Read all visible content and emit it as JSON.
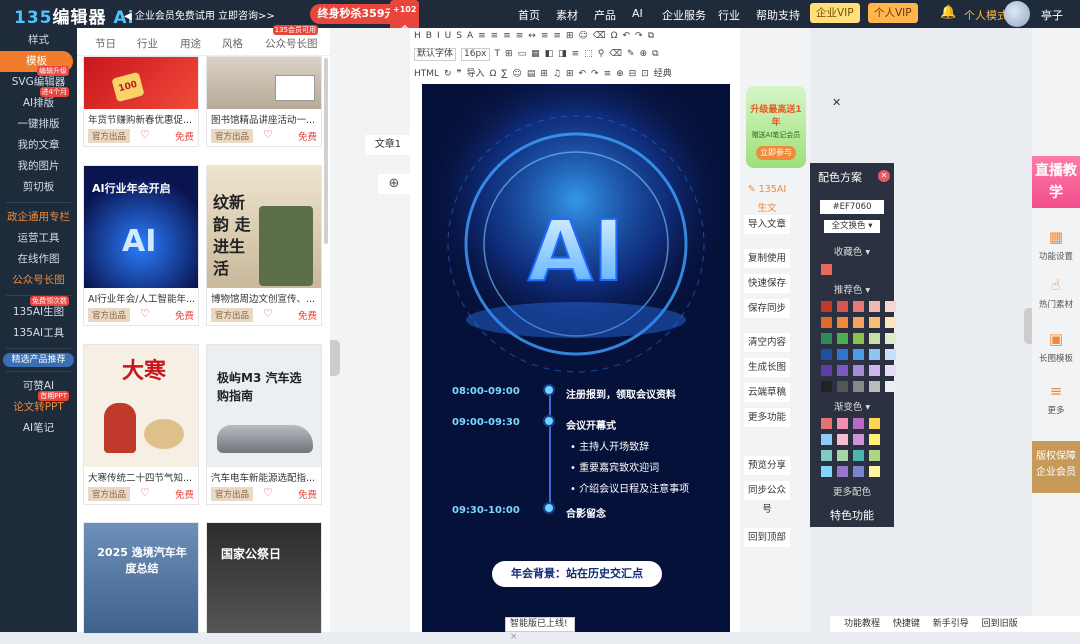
{
  "topbar": {
    "logo_num": "135",
    "logo_text": "编辑器",
    "logo_ai": "Ai",
    "promo": "◀ 企业会员免费试用 立即咨询>>",
    "flash": "终身秒杀359元起",
    "flash_tag": "+102个",
    "nav": [
      "首页",
      "素材",
      "产品",
      "AI",
      "企业服务",
      "行业",
      "帮助支持"
    ],
    "enterprise_vip": "企业VIP",
    "personal_vip": "个人VIP",
    "mode": "个人模式",
    "username": "亭子",
    "bell_icon": "bell-icon"
  },
  "sidebar": {
    "items": [
      {
        "label": "样式"
      },
      {
        "label": "模板",
        "active": true
      },
      {
        "label": "SVG编辑器",
        "badge": "编辑升级"
      },
      {
        "label": "AI排版",
        "badge": "进4个月"
      },
      {
        "label": "一键排版"
      },
      {
        "label": "我的文章"
      },
      {
        "label": "我的图片"
      },
      {
        "label": "剪切板"
      }
    ],
    "items2": [
      {
        "label": "政企通用专栏",
        "orange": true
      },
      {
        "label": "运营工具"
      },
      {
        "label": "在线作图"
      },
      {
        "label": "公众号长图",
        "orange": true
      }
    ],
    "items3": [
      {
        "label": "135AI生图",
        "badge": "免费领次数"
      },
      {
        "label": "135AI工具"
      }
    ],
    "mini_banner": "精选产品推荐",
    "items4": [
      {
        "label": "可赞AI"
      },
      {
        "label": "论文转PPT",
        "badge": "首期PPT",
        "orange": true
      },
      {
        "label": "AI笔记"
      }
    ]
  },
  "templates": {
    "tabs": [
      "节日",
      "行业",
      "用途",
      "风格",
      "公众号长图"
    ],
    "tab_badge": "135会员可用",
    "official": "官方出品",
    "free": "免费",
    "cards": [
      {
        "title": "年货节赚购新春优惠促...",
        "thumb_text": "100"
      },
      {
        "title": "图书馆精品讲座活动一...",
        "thumb_text": ""
      },
      {
        "title": "AI行业年会/人工智能年...",
        "thumb_text": "AI行业年会开启"
      },
      {
        "title": "博物馆周边文创宣传、...",
        "thumb_text": "纹新韵 走进生活"
      },
      {
        "title": "大寒传统二十四节气知...",
        "thumb_text": "大寒"
      },
      {
        "title": "汽车电车新能源选配指...",
        "thumb_text": "极屿M3 汽车选购指南"
      },
      {
        "title": "",
        "thumb_text": "2025 逸境汽车年度总结"
      },
      {
        "title": "",
        "thumb_text": "国家公祭日"
      }
    ]
  },
  "middle": {
    "tab_label": "文章1",
    "add_label": "⊕"
  },
  "editor": {
    "toolbar_row1": [
      "H",
      "B",
      "I",
      "U",
      "S",
      "A",
      "≡",
      "≡",
      "≡",
      "≡",
      "↔",
      "≡",
      "≡",
      "⊞",
      "☺",
      "⌫",
      "Ω",
      "↶",
      "↷",
      "⧉"
    ],
    "toolbar_row2": [
      "默认字体",
      "16px",
      "T",
      "⊞",
      "▭",
      "▦",
      "◧",
      "◨",
      "≡",
      "⬚",
      "⚲",
      "⌫",
      "✎",
      "⊕",
      "⧉"
    ],
    "toolbar_row3": [
      "HTML",
      "↻",
      "❞",
      "导入",
      "Ω",
      "∑",
      "☺",
      "▤",
      "⊞",
      "♫",
      "⊞",
      "↶",
      "↷",
      "≡",
      "⊕",
      "⊟",
      "⊡",
      "经典"
    ],
    "poster": {
      "schedule": [
        {
          "time": "08:00-09:00",
          "event": "注册报到，领取会议资料"
        },
        {
          "time": "09:00-09:30",
          "event": "会议开幕式"
        },
        {
          "time": "09:30-10:00",
          "event": "合影留念"
        }
      ],
      "sub_items": [
        "主持人开场致辞",
        "重要嘉宾致欢迎词",
        "介绍会议日程及注意事项"
      ],
      "background_title": "年会背景：站在历史交汇点"
    },
    "notice": "智能版已上线!"
  },
  "right_tools": {
    "ai_write": "135AI生文",
    "ad_text": "升级最高送1年",
    "ad_sub": "赠送AI笔记会员",
    "ad_btn": "立即参与",
    "buttons": [
      "导入文章",
      "复制使用",
      "快速保存",
      "保存同步",
      "清空内容",
      "生成长图",
      "云端草稿",
      "更多功能",
      "预览分享",
      "同步公众号",
      "回到顶部"
    ]
  },
  "color_panel": {
    "title": "配色方案",
    "hex_value": "#EF7060",
    "select": "全文换色",
    "collected": "收藏色",
    "recommended": "推荐色",
    "gradient": "渐变色",
    "more": "更多配色",
    "special": "特色功能",
    "collected_color": "#e56a5c",
    "recommended_colors": [
      "#c0392b",
      "#d9534f",
      "#e8787a",
      "#f2b8b5",
      "#f5d6d0",
      "#e06a2c",
      "#f08a3a",
      "#f4a460",
      "#f6c177",
      "#fde5c0",
      "#2e8b57",
      "#4caf50",
      "#8bc34a",
      "#c5e1a5",
      "#dcedc8",
      "#1e4fa3",
      "#2f74d0",
      "#4a9be8",
      "#8ec5f2",
      "#c6e2f9",
      "#5b3ea8",
      "#7e57c2",
      "#a78bd6",
      "#cbb8ea",
      "#e5dcf5",
      "#222222",
      "#555555",
      "#888888",
      "#bbbbbb",
      "#eeeeee"
    ],
    "gradient_colors": [
      "#e57373",
      "#f48fb1",
      "#ba68c8",
      "#ffd54f",
      "#90caf9",
      "#f8bbd0",
      "#ce93d8",
      "#fff176",
      "#80cbc4",
      "#a5d6a7",
      "#4db6ac",
      "#aed581",
      "#81d4fa",
      "#9575cd",
      "#7986cb",
      "#fff59d"
    ]
  },
  "right_bar": {
    "live": "直播教学",
    "items": [
      {
        "label": "功能设置",
        "icon": "grid-icon"
      },
      {
        "label": "热门素材",
        "icon": "hand-icon"
      },
      {
        "label": "长图模板",
        "icon": "image-icon"
      },
      {
        "label": "更多",
        "icon": "menu-icon"
      }
    ],
    "badge": "版权保障企业会员"
  },
  "bottom_bar": [
    "功能教程",
    "快捷键",
    "新手引导",
    "回到旧版"
  ]
}
